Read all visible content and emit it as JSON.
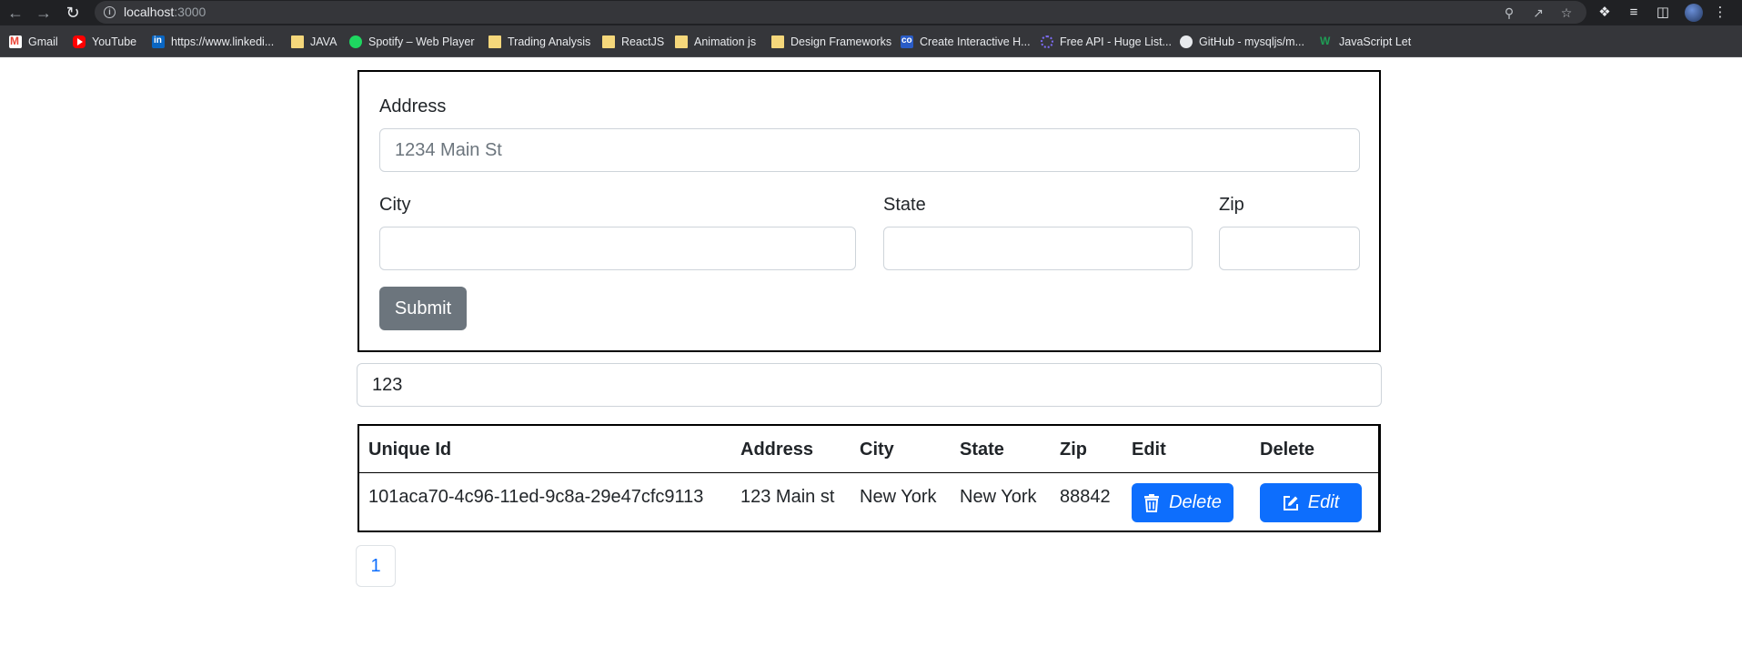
{
  "browser": {
    "url_host": "localhost",
    "url_port": ":3000",
    "bookmarks": [
      {
        "label": "Gmail",
        "icon": "gmail-icon"
      },
      {
        "label": "YouTube",
        "icon": "youtube-icon"
      },
      {
        "label": "https://www.linkedi...",
        "icon": "linkedin-icon"
      },
      {
        "label": "JAVA",
        "icon": "folder-icon"
      },
      {
        "label": "Spotify – Web Player",
        "icon": "spotify-icon"
      },
      {
        "label": "Trading Analysis",
        "icon": "folder-icon"
      },
      {
        "label": "ReactJS",
        "icon": "folder-icon"
      },
      {
        "label": "Animation js",
        "icon": "folder-icon"
      },
      {
        "label": "Design Frameworks",
        "icon": "folder-icon"
      },
      {
        "label": "Create Interactive H...",
        "icon": "codepen-icon"
      },
      {
        "label": "Free API - Huge List...",
        "icon": "api-icon"
      },
      {
        "label": "GitHub - mysqljs/m...",
        "icon": "github-icon"
      },
      {
        "label": "JavaScript Let",
        "icon": "w3-icon"
      }
    ]
  },
  "form": {
    "address_label": "Address",
    "address_placeholder": "1234 Main St",
    "address_value": "",
    "city_label": "City",
    "city_value": "",
    "state_label": "State",
    "state_value": "",
    "zip_label": "Zip",
    "zip_value": "",
    "submit_label": "Submit"
  },
  "search": {
    "value": "123"
  },
  "table": {
    "headers": [
      "Unique Id",
      "Address",
      "City",
      "State",
      "Zip",
      "Edit",
      "Delete"
    ],
    "rows": [
      {
        "unique_id": "101aca70-4c96-11ed-9c8a-29e47cfc9113",
        "address": "123 Main st",
        "city": "New York",
        "state": "New York",
        "zip": "88842",
        "edit_col_button": "Delete",
        "delete_col_button": "Edit"
      }
    ]
  },
  "pagination": {
    "pages": [
      "1"
    ]
  },
  "colors": {
    "primary": "#0d6efd",
    "secondary": "#6c757d",
    "chrome_dark": "#202124",
    "bookmark_bar": "#35363a"
  }
}
